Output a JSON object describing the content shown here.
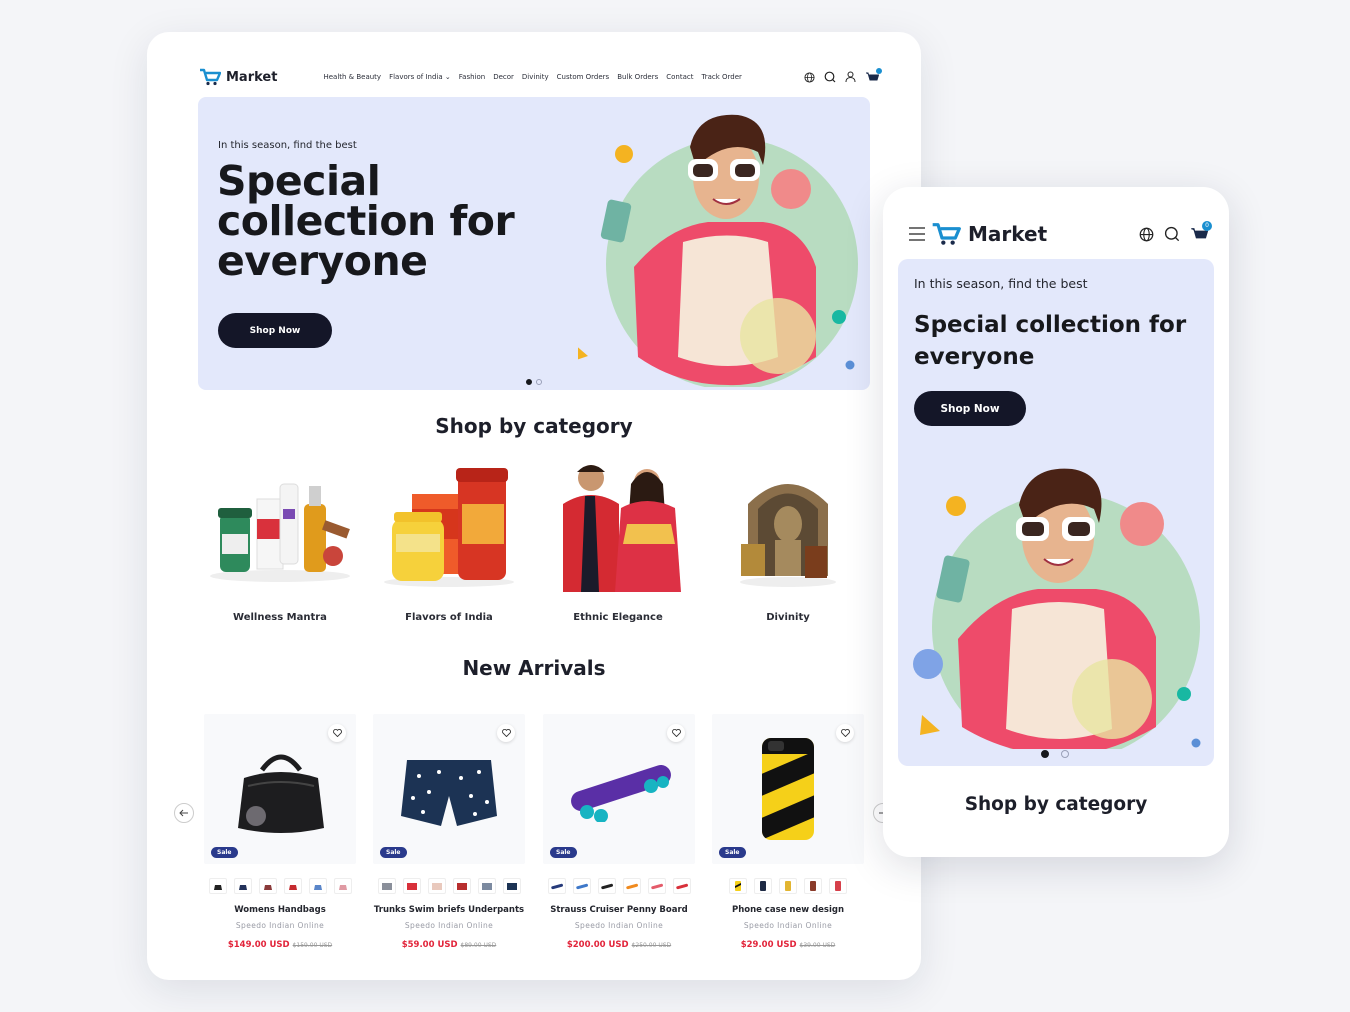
{
  "brand": {
    "name": "Market",
    "accent": "#1a8fd0",
    "dark": "#141628",
    "sale": "#e2243a"
  },
  "nav": {
    "items": [
      "Health & Beauty",
      "Flavors of India",
      "Fashion",
      "Decor",
      "Divinity",
      "Custom Orders",
      "Bulk Orders",
      "Contact",
      "Track Order"
    ],
    "icons": [
      "globe-icon",
      "search-icon",
      "user-icon",
      "cart-icon"
    ],
    "cart_count": "0"
  },
  "hero": {
    "eyebrow": "In this season, find the best",
    "headline": "Special collection for everyone",
    "cta": "Shop Now",
    "slides": 2,
    "active_slide": 1
  },
  "categories": {
    "title": "Shop by category",
    "items": [
      {
        "label": "Wellness Mantra"
      },
      {
        "label": "Flavors of India"
      },
      {
        "label": "Ethnic Elegance"
      },
      {
        "label": "Divinity"
      }
    ]
  },
  "arrivals": {
    "title": "New Arrivals",
    "badge": "Sale",
    "products": [
      {
        "name": "Womens Handbags",
        "vendor": "Speedo Indian Online",
        "price": "$149.00 USD",
        "compare": "$159.00 USD"
      },
      {
        "name": "Trunks Swim briefs Underpants",
        "vendor": "Speedo Indian Online",
        "price": "$59.00 USD",
        "compare": "$89.00 USD"
      },
      {
        "name": "Strauss Cruiser Penny Board",
        "vendor": "Speedo Indian Online",
        "price": "$200.00 USD",
        "compare": "$250.00 USD"
      },
      {
        "name": "Phone case new design",
        "vendor": "Speedo Indian Online",
        "price": "$29.00 USD",
        "compare": "$39.00 USD"
      }
    ]
  },
  "mobile": {
    "eyebrow": "In this season, find the best",
    "headline": "Special collection for everyone",
    "cta": "Shop Now",
    "section_title": "Shop by category"
  }
}
